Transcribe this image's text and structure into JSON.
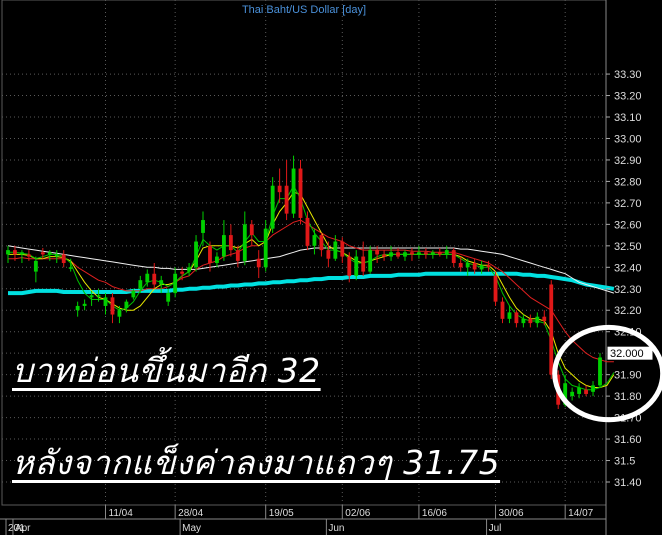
{
  "chart_data": {
    "type": "candlestick",
    "title": "Thai Baht/US Dollar [day]",
    "price_label": "32.000",
    "ylim": [
      31.32,
      33.42
    ],
    "y_ticks": [
      31.4,
      31.5,
      31.6,
      31.7,
      31.8,
      31.9,
      32.0,
      32.1,
      32.2,
      32.3,
      32.4,
      32.5,
      32.6,
      32.7,
      32.8,
      32.9,
      33.0,
      33.1,
      33.2,
      33.3
    ],
    "y_tick_labels": [
      "31.40",
      "31.5",
      "31.60",
      "31.70",
      "31.80",
      "31.90",
      "32",
      "32.10",
      "32.20",
      "32.30",
      "32.40",
      "32.50",
      "32.60",
      "32.70",
      "32.80",
      "32.90",
      "33.00",
      "33.10",
      "33.20",
      "33.30"
    ],
    "x_day_labels": [
      {
        "i": 14,
        "label": "11/04"
      },
      {
        "i": 24,
        "label": "28/04"
      },
      {
        "i": 37,
        "label": "19/05"
      },
      {
        "i": 48,
        "label": "02/06"
      },
      {
        "i": 59,
        "label": "16/06"
      },
      {
        "i": 70,
        "label": "30/06"
      },
      {
        "i": 80,
        "label": "14/07"
      }
    ],
    "x_month_labels": [
      {
        "i": 0,
        "label": "201"
      },
      {
        "i": 1,
        "label": "Apr"
      },
      {
        "i": 25,
        "label": "May"
      },
      {
        "i": 46,
        "label": "Jun"
      },
      {
        "i": 69,
        "label": "Jul"
      }
    ],
    "candles": [
      {
        "o": 32.46,
        "h": 32.5,
        "l": 32.42,
        "c": 32.48
      },
      {
        "o": 32.48,
        "h": 32.5,
        "l": 32.43,
        "c": 32.46
      },
      {
        "o": 32.46,
        "h": 32.48,
        "l": 32.42,
        "c": 32.47
      },
      {
        "o": 32.46,
        "h": 32.48,
        "l": 32.43,
        "c": 32.45
      },
      {
        "o": 32.38,
        "h": 32.45,
        "l": 32.33,
        "c": 32.43
      },
      {
        "o": 32.47,
        "h": 32.49,
        "l": 32.44,
        "c": 32.46
      },
      {
        "o": 32.46,
        "h": 32.48,
        "l": 32.43,
        "c": 32.47
      },
      {
        "o": 32.45,
        "h": 32.48,
        "l": 32.42,
        "c": 32.46
      },
      {
        "o": 32.46,
        "h": 32.48,
        "l": 32.4,
        "c": 32.42
      },
      {
        "o": 32.4,
        "h": 32.44,
        "l": 32.38,
        "c": 32.4
      },
      {
        "o": 32.2,
        "h": 32.24,
        "l": 32.17,
        "c": 32.22
      },
      {
        "o": 32.22,
        "h": 32.25,
        "l": 32.2,
        "c": 32.23
      },
      {
        "o": 32.26,
        "h": 32.29,
        "l": 32.22,
        "c": 32.27
      },
      {
        "o": 32.27,
        "h": 32.3,
        "l": 32.24,
        "c": 32.27
      },
      {
        "o": 32.22,
        "h": 32.28,
        "l": 32.18,
        "c": 32.26
      },
      {
        "o": 32.26,
        "h": 32.28,
        "l": 32.14,
        "c": 32.18
      },
      {
        "o": 32.17,
        "h": 32.22,
        "l": 32.14,
        "c": 32.2
      },
      {
        "o": 32.21,
        "h": 32.25,
        "l": 32.19,
        "c": 32.24
      },
      {
        "o": 32.26,
        "h": 32.3,
        "l": 32.25,
        "c": 32.29
      },
      {
        "o": 32.3,
        "h": 32.36,
        "l": 32.28,
        "c": 32.34
      },
      {
        "o": 32.33,
        "h": 32.39,
        "l": 32.31,
        "c": 32.37
      },
      {
        "o": 32.37,
        "h": 32.42,
        "l": 32.3,
        "c": 32.32
      },
      {
        "o": 32.32,
        "h": 32.36,
        "l": 32.28,
        "c": 32.34
      },
      {
        "o": 32.24,
        "h": 32.3,
        "l": 32.22,
        "c": 32.28
      },
      {
        "o": 32.28,
        "h": 32.4,
        "l": 32.26,
        "c": 32.37
      },
      {
        "o": 32.38,
        "h": 32.4,
        "l": 32.34,
        "c": 32.37
      },
      {
        "o": 32.38,
        "h": 32.42,
        "l": 32.36,
        "c": 32.4
      },
      {
        "o": 32.4,
        "h": 32.55,
        "l": 32.38,
        "c": 32.52
      },
      {
        "o": 32.56,
        "h": 32.66,
        "l": 32.5,
        "c": 32.62
      },
      {
        "o": 32.5,
        "h": 32.52,
        "l": 32.38,
        "c": 32.42
      },
      {
        "o": 32.42,
        "h": 32.47,
        "l": 32.4,
        "c": 32.45
      },
      {
        "o": 32.45,
        "h": 32.62,
        "l": 32.43,
        "c": 32.55
      },
      {
        "o": 32.55,
        "h": 32.6,
        "l": 32.45,
        "c": 32.48
      },
      {
        "o": 32.48,
        "h": 32.5,
        "l": 32.4,
        "c": 32.43
      },
      {
        "o": 32.43,
        "h": 32.66,
        "l": 32.41,
        "c": 32.6
      },
      {
        "o": 32.6,
        "h": 32.62,
        "l": 32.5,
        "c": 32.55
      },
      {
        "o": 32.44,
        "h": 32.48,
        "l": 32.35,
        "c": 32.4
      },
      {
        "o": 32.4,
        "h": 32.62,
        "l": 32.38,
        "c": 32.58
      },
      {
        "o": 32.58,
        "h": 32.82,
        "l": 32.56,
        "c": 32.78
      },
      {
        "o": 32.78,
        "h": 32.86,
        "l": 32.7,
        "c": 32.75
      },
      {
        "o": 32.78,
        "h": 32.9,
        "l": 32.62,
        "c": 32.65
      },
      {
        "o": 32.65,
        "h": 32.92,
        "l": 32.63,
        "c": 32.86
      },
      {
        "o": 32.86,
        "h": 32.9,
        "l": 32.6,
        "c": 32.63
      },
      {
        "o": 32.63,
        "h": 32.66,
        "l": 32.48,
        "c": 32.5
      },
      {
        "o": 32.5,
        "h": 32.58,
        "l": 32.46,
        "c": 32.55
      },
      {
        "o": 32.55,
        "h": 32.56,
        "l": 32.45,
        "c": 32.48
      },
      {
        "o": 32.48,
        "h": 32.52,
        "l": 32.4,
        "c": 32.44
      },
      {
        "o": 32.44,
        "h": 32.55,
        "l": 32.43,
        "c": 32.52
      },
      {
        "o": 32.52,
        "h": 32.54,
        "l": 32.42,
        "c": 32.45
      },
      {
        "o": 32.45,
        "h": 32.47,
        "l": 32.33,
        "c": 32.36
      },
      {
        "o": 32.36,
        "h": 32.48,
        "l": 32.34,
        "c": 32.45
      },
      {
        "o": 32.45,
        "h": 32.52,
        "l": 32.36,
        "c": 32.38
      },
      {
        "o": 32.38,
        "h": 32.5,
        "l": 32.37,
        "c": 32.48
      },
      {
        "o": 32.48,
        "h": 32.5,
        "l": 32.42,
        "c": 32.46
      },
      {
        "o": 32.46,
        "h": 32.48,
        "l": 32.43,
        "c": 32.45
      },
      {
        "o": 32.45,
        "h": 32.5,
        "l": 32.43,
        "c": 32.47
      },
      {
        "o": 32.47,
        "h": 32.49,
        "l": 32.44,
        "c": 32.45
      },
      {
        "o": 32.45,
        "h": 32.48,
        "l": 32.43,
        "c": 32.47
      },
      {
        "o": 32.47,
        "h": 32.49,
        "l": 32.43,
        "c": 32.46
      },
      {
        "o": 32.46,
        "h": 32.5,
        "l": 32.44,
        "c": 32.47
      },
      {
        "o": 32.47,
        "h": 32.49,
        "l": 32.44,
        "c": 32.46
      },
      {
        "o": 32.46,
        "h": 32.48,
        "l": 32.44,
        "c": 32.47
      },
      {
        "o": 32.47,
        "h": 32.49,
        "l": 32.45,
        "c": 32.46
      },
      {
        "o": 32.46,
        "h": 32.5,
        "l": 32.44,
        "c": 32.48
      },
      {
        "o": 32.48,
        "h": 32.49,
        "l": 32.4,
        "c": 32.42
      },
      {
        "o": 32.42,
        "h": 32.45,
        "l": 32.38,
        "c": 32.4
      },
      {
        "o": 32.4,
        "h": 32.44,
        "l": 32.36,
        "c": 32.42
      },
      {
        "o": 32.42,
        "h": 32.44,
        "l": 32.37,
        "c": 32.39
      },
      {
        "o": 32.39,
        "h": 32.43,
        "l": 32.37,
        "c": 32.41
      },
      {
        "o": 32.41,
        "h": 32.43,
        "l": 32.38,
        "c": 32.4
      },
      {
        "o": 32.36,
        "h": 32.38,
        "l": 32.22,
        "c": 32.24
      },
      {
        "o": 32.24,
        "h": 32.26,
        "l": 32.14,
        "c": 32.16
      },
      {
        "o": 32.16,
        "h": 32.22,
        "l": 32.14,
        "c": 32.19
      },
      {
        "o": 32.19,
        "h": 32.2,
        "l": 32.12,
        "c": 32.14
      },
      {
        "o": 32.14,
        "h": 32.18,
        "l": 32.12,
        "c": 32.16
      },
      {
        "o": 32.16,
        "h": 32.18,
        "l": 32.12,
        "c": 32.14
      },
      {
        "o": 32.14,
        "h": 32.19,
        "l": 32.12,
        "c": 32.17
      },
      {
        "o": 32.17,
        "h": 32.2,
        "l": 32.13,
        "c": 32.15
      },
      {
        "o": 32.32,
        "h": 32.34,
        "l": 31.88,
        "c": 31.9
      },
      {
        "o": 31.9,
        "h": 31.92,
        "l": 31.74,
        "c": 31.76
      },
      {
        "o": 31.76,
        "h": 31.9,
        "l": 31.75,
        "c": 31.86
      },
      {
        "o": 31.8,
        "h": 31.84,
        "l": 31.78,
        "c": 31.82
      },
      {
        "o": 31.81,
        "h": 31.86,
        "l": 31.79,
        "c": 31.84
      },
      {
        "o": 31.83,
        "h": 31.85,
        "l": 31.8,
        "c": 31.81
      },
      {
        "o": 31.82,
        "h": 31.87,
        "l": 31.8,
        "c": 31.85
      },
      {
        "o": 31.85,
        "h": 32.0,
        "l": 31.84,
        "c": 31.98
      }
    ],
    "series": [
      {
        "color": "#00e0e0",
        "values": [
          32.28,
          32.28,
          32.28,
          32.285,
          32.29,
          32.29,
          32.29,
          32.29,
          32.285,
          32.285,
          32.285,
          32.285,
          32.285,
          32.285,
          32.285,
          32.285,
          32.285,
          32.285,
          32.29,
          32.29,
          32.29,
          32.29,
          32.29,
          32.29,
          32.295,
          32.295,
          32.3,
          32.3,
          32.305,
          32.305,
          32.31,
          32.31,
          32.315,
          32.315,
          32.32,
          32.32,
          32.325,
          32.325,
          32.33,
          32.33,
          32.335,
          32.335,
          32.34,
          32.34,
          32.345,
          32.345,
          32.35,
          32.35,
          32.35,
          32.355,
          32.355,
          32.355,
          32.36,
          32.36,
          32.36,
          32.36,
          32.365,
          32.365,
          32.365,
          32.365,
          32.37,
          32.37,
          32.37,
          32.37,
          32.37,
          32.37,
          32.37,
          32.37,
          32.37,
          32.37,
          32.37,
          32.37,
          32.37,
          32.37,
          32.365,
          32.365,
          32.36,
          32.36,
          32.355,
          32.35,
          32.345,
          32.34,
          32.33,
          32.32,
          32.315,
          32.31,
          32.305,
          32.3
        ]
      },
      {
        "color": "#f0f0f0",
        "values": [
          32.5,
          32.495,
          32.49,
          32.485,
          32.48,
          32.475,
          32.47,
          32.465,
          32.46,
          32.455,
          32.45,
          32.445,
          32.44,
          32.435,
          32.43,
          32.425,
          32.42,
          32.415,
          32.41,
          32.405,
          32.4,
          32.4,
          32.395,
          32.395,
          32.39,
          32.39,
          32.39,
          32.39,
          32.395,
          32.4,
          32.405,
          32.41,
          32.415,
          32.42,
          32.425,
          32.43,
          32.435,
          32.44,
          32.445,
          32.45,
          32.46,
          32.47,
          32.48,
          32.485,
          32.49,
          32.49,
          32.49,
          32.49,
          32.49,
          32.49,
          32.49,
          32.49,
          32.49,
          32.49,
          32.49,
          32.49,
          32.49,
          32.49,
          32.49,
          32.49,
          32.49,
          32.49,
          32.49,
          32.49,
          32.49,
          32.485,
          32.485,
          32.48,
          32.475,
          32.47,
          32.465,
          32.46,
          32.45,
          32.44,
          32.43,
          32.42,
          32.41,
          32.4,
          32.39,
          32.38,
          32.37,
          32.35,
          32.33,
          32.32,
          32.31,
          32.3,
          32.29,
          32.28
        ]
      },
      {
        "color": "#e02020",
        "values": [
          32.44,
          32.44,
          32.445,
          32.44,
          32.44,
          32.44,
          32.44,
          32.44,
          32.44,
          32.43,
          32.4,
          32.38,
          32.36,
          32.34,
          32.33,
          32.31,
          32.3,
          32.29,
          32.29,
          32.29,
          32.3,
          32.3,
          32.3,
          32.31,
          32.33,
          32.35,
          32.36,
          32.39,
          32.41,
          32.42,
          32.43,
          32.45,
          32.46,
          32.47,
          32.49,
          32.5,
          32.5,
          32.52,
          32.55,
          32.57,
          32.59,
          32.61,
          32.62,
          32.6,
          32.58,
          32.56,
          32.54,
          32.53,
          32.52,
          32.5,
          32.49,
          32.48,
          32.48,
          32.48,
          32.48,
          32.48,
          32.48,
          32.48,
          32.475,
          32.475,
          32.475,
          32.47,
          32.47,
          32.47,
          32.47,
          32.46,
          32.45,
          32.44,
          32.43,
          32.42,
          32.4,
          32.38,
          32.35,
          32.32,
          32.29,
          32.26,
          32.24,
          32.22,
          32.2,
          32.15,
          32.1,
          32.06,
          32.03,
          32.0,
          31.98,
          31.97,
          31.96,
          31.96
        ]
      },
      {
        "color": "#e8e800",
        "values": [
          32.46,
          32.46,
          32.46,
          32.455,
          32.44,
          32.44,
          32.45,
          32.45,
          32.445,
          32.43,
          32.38,
          32.33,
          32.29,
          32.26,
          32.25,
          32.23,
          32.21,
          32.2,
          32.2,
          32.22,
          32.26,
          32.3,
          32.32,
          32.32,
          32.33,
          32.36,
          32.38,
          32.43,
          32.49,
          32.5,
          32.5,
          32.5,
          32.5,
          32.49,
          32.51,
          32.53,
          32.5,
          32.52,
          32.6,
          32.66,
          32.7,
          32.75,
          32.74,
          32.68,
          32.62,
          32.56,
          32.5,
          32.48,
          32.47,
          32.45,
          32.43,
          32.42,
          32.43,
          32.44,
          32.45,
          32.46,
          32.46,
          32.46,
          32.46,
          32.46,
          32.46,
          32.46,
          32.46,
          32.46,
          32.46,
          32.45,
          32.43,
          32.42,
          32.41,
          32.41,
          32.38,
          32.32,
          32.26,
          32.21,
          32.18,
          32.16,
          32.16,
          32.15,
          32.1,
          32.0,
          31.93,
          31.9,
          31.87,
          31.85,
          31.84,
          31.84,
          31.85,
          31.9
        ]
      },
      {
        "color": "#00c000",
        "values": [
          32.47,
          32.47,
          32.465,
          32.46,
          32.44,
          32.45,
          32.46,
          32.46,
          32.45,
          32.42,
          32.34,
          32.28,
          32.25,
          32.25,
          32.25,
          32.22,
          32.2,
          32.21,
          32.24,
          32.29,
          32.33,
          32.34,
          32.33,
          32.31,
          32.33,
          32.36,
          32.38,
          32.45,
          32.53,
          32.5,
          32.48,
          32.5,
          32.5,
          32.47,
          32.52,
          32.56,
          32.52,
          32.52,
          32.64,
          32.72,
          32.72,
          32.78,
          32.72,
          32.62,
          32.56,
          32.52,
          32.48,
          32.48,
          32.47,
          32.44,
          32.42,
          32.42,
          32.43,
          32.45,
          32.46,
          32.46,
          32.46,
          32.46,
          32.46,
          32.46,
          32.46,
          32.46,
          32.46,
          32.46,
          32.46,
          32.44,
          32.42,
          32.41,
          32.4,
          32.4,
          32.36,
          32.28,
          32.22,
          32.18,
          32.16,
          32.15,
          32.15,
          32.14,
          32.06,
          31.96,
          31.88,
          31.85,
          31.84,
          31.83,
          31.83,
          31.84,
          31.86,
          31.91
        ]
      }
    ],
    "annotation_ellipse": {
      "x_start_index": 78.5,
      "x_end_index": 94,
      "y_top": 32.12,
      "y_bottom": 31.69
    }
  },
  "annotation": {
    "line1": "บาทอ่อนขึ้นมาอีก 32",
    "line2": "หลังจากแข็งค่าลงมาแถวๆ 31.75"
  },
  "colors": {
    "background": "#000000",
    "grid": "#5a5a5a",
    "up_candle": "#00d000",
    "down_candle": "#e01818",
    "title": "#4a90d9"
  }
}
